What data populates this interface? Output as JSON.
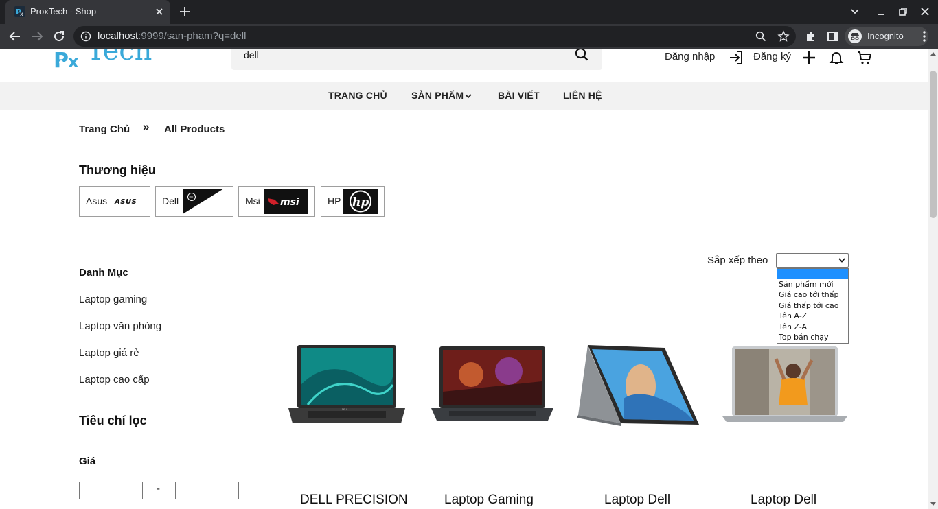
{
  "browser": {
    "tab_title": "ProxTech - Shop",
    "url_host": "localhost",
    "url_path": ":9999/san-pham?q=dell",
    "profile_label": "Incognito"
  },
  "header": {
    "logo_text": "Tech",
    "search_value": "dell",
    "login_label": "Đăng nhập",
    "register_label": "Đăng ký"
  },
  "nav": {
    "items": [
      "TRANG CHỦ",
      "SẢN PHẨM",
      "BÀI VIẾT",
      "LIÊN HỆ"
    ]
  },
  "breadcrumb": {
    "home": "Trang Chủ",
    "separator": "»",
    "current": "All Products"
  },
  "brands": {
    "title": "Thương hiệu",
    "items": [
      {
        "name": "Asus",
        "logo": "asus-logo"
      },
      {
        "name": "Dell",
        "logo": "dell-logo"
      },
      {
        "name": "Msi",
        "logo": "msi-logo"
      },
      {
        "name": "HP",
        "logo": "hp-logo"
      }
    ]
  },
  "categories": {
    "title": "Danh Mục",
    "items": [
      "Laptop gaming",
      "Laptop văn phòng",
      "Laptop giá rẻ",
      "Laptop cao cấp"
    ]
  },
  "filters": {
    "title": "Tiêu chí lọc",
    "price_label": "Giá",
    "price_separator": "-"
  },
  "sort": {
    "label": "Sắp xếp theo",
    "options": [
      "",
      "Sản phẩm mới",
      "Giá cao tới thấp",
      "Giá thấp tới cao",
      "Tên A-Z",
      "Tên Z-A",
      "Top bán chạy"
    ]
  },
  "products": [
    {
      "name": "DELL PRECISION"
    },
    {
      "name": "Laptop Gaming"
    },
    {
      "name": "Laptop Dell"
    },
    {
      "name": "Laptop Dell"
    }
  ],
  "colors": {
    "chrome_dark": "#202124",
    "chrome_tab": "#35363a",
    "logo_blue": "#3aa9d9",
    "nav_bg": "#f2f2f2",
    "dropdown_highlight": "#1e90ff"
  }
}
